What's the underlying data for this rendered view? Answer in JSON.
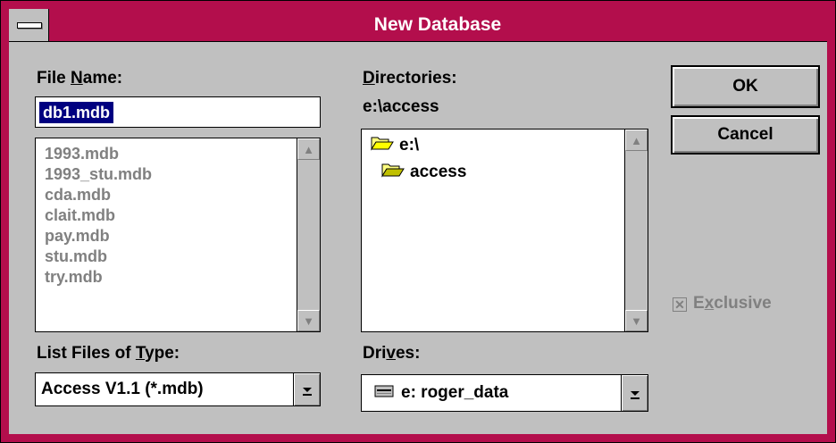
{
  "window": {
    "title": "New Database"
  },
  "file_name": {
    "label_pre": "File ",
    "label_ul": "N",
    "label_post": "ame:",
    "value": "db1.mdb"
  },
  "files": [
    "1993.mdb",
    "1993_stu.mdb",
    "cda.mdb",
    "clait.mdb",
    "pay.mdb",
    "stu.mdb",
    "try.mdb"
  ],
  "directories": {
    "label_ul": "D",
    "label_post": "irectories:",
    "current_path": "e:\\access",
    "items": [
      "e:\\",
      "access"
    ]
  },
  "buttons": {
    "ok": "OK",
    "cancel": "Cancel"
  },
  "exclusive": {
    "label_pre": "E",
    "label_ul": "x",
    "label_post": "clusive",
    "checked": true
  },
  "file_type": {
    "label_pre": "List Files of ",
    "label_ul": "T",
    "label_post": "ype:",
    "value": "Access V1.1 (*.mdb)"
  },
  "drives": {
    "label_pre": "Dri",
    "label_ul": "v",
    "label_post": "es:",
    "value": "e: roger_data"
  },
  "icons": {
    "system_menu": "system-menu-icon",
    "scroll_up": "scroll-up-arrow-icon",
    "scroll_down": "scroll-down-arrow-icon",
    "open_folder": "open-folder-icon",
    "drive": "drive-icon",
    "dropdown": "dropdown-arrow-icon"
  },
  "colors": {
    "titlebar": "#b30e4c",
    "face": "#c0c0c0",
    "selection": "#000080",
    "disabled_text": "#808080"
  }
}
